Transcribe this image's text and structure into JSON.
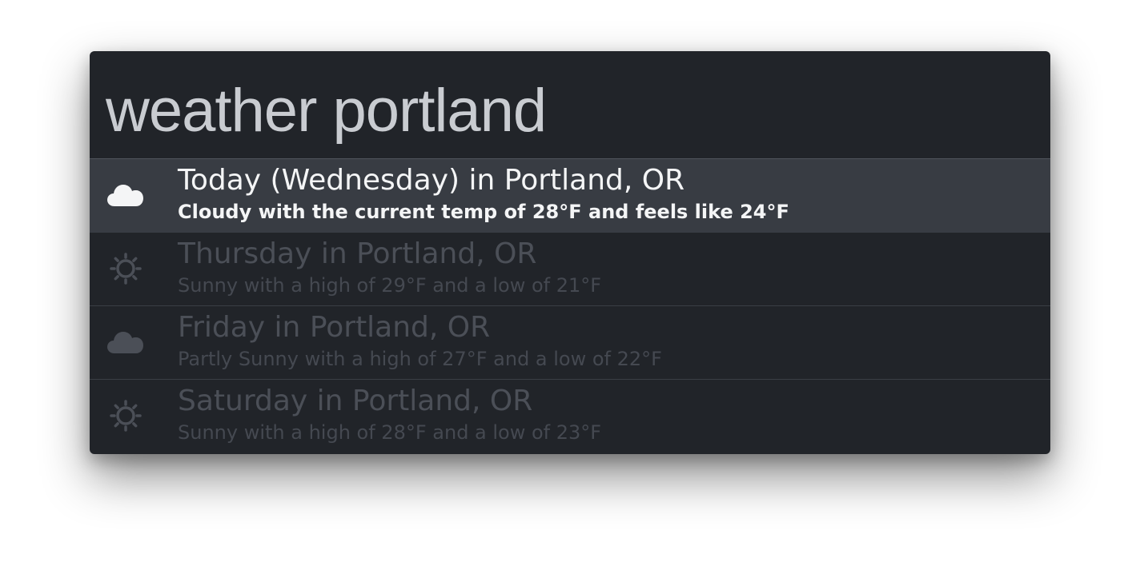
{
  "search": {
    "query": "weather portland"
  },
  "results": [
    {
      "title": "Today (Wednesday) in Portland, OR",
      "subtitle": "Cloudy with the current temp of 28°F and feels like 24°F",
      "icon": "cloud-icon",
      "selected": true
    },
    {
      "title": "Thursday in Portland, OR",
      "subtitle": "Sunny with a high of 29°F and a low of 21°F",
      "icon": "sun-icon",
      "selected": false
    },
    {
      "title": "Friday in Portland, OR",
      "subtitle": "Partly Sunny with a high of 27°F and a low of 22°F",
      "icon": "cloud-icon",
      "selected": false
    },
    {
      "title": "Saturday in Portland, OR",
      "subtitle": "Sunny with a high of 28°F and a low of 23°F",
      "icon": "sun-icon",
      "selected": false
    }
  ],
  "colors": {
    "window_background": "#212429",
    "selected_row_background": "#383c43",
    "query_text": "#c9ccd1",
    "selected_text": "#f4f5f6",
    "dimmed_text": "#4b4f57"
  }
}
